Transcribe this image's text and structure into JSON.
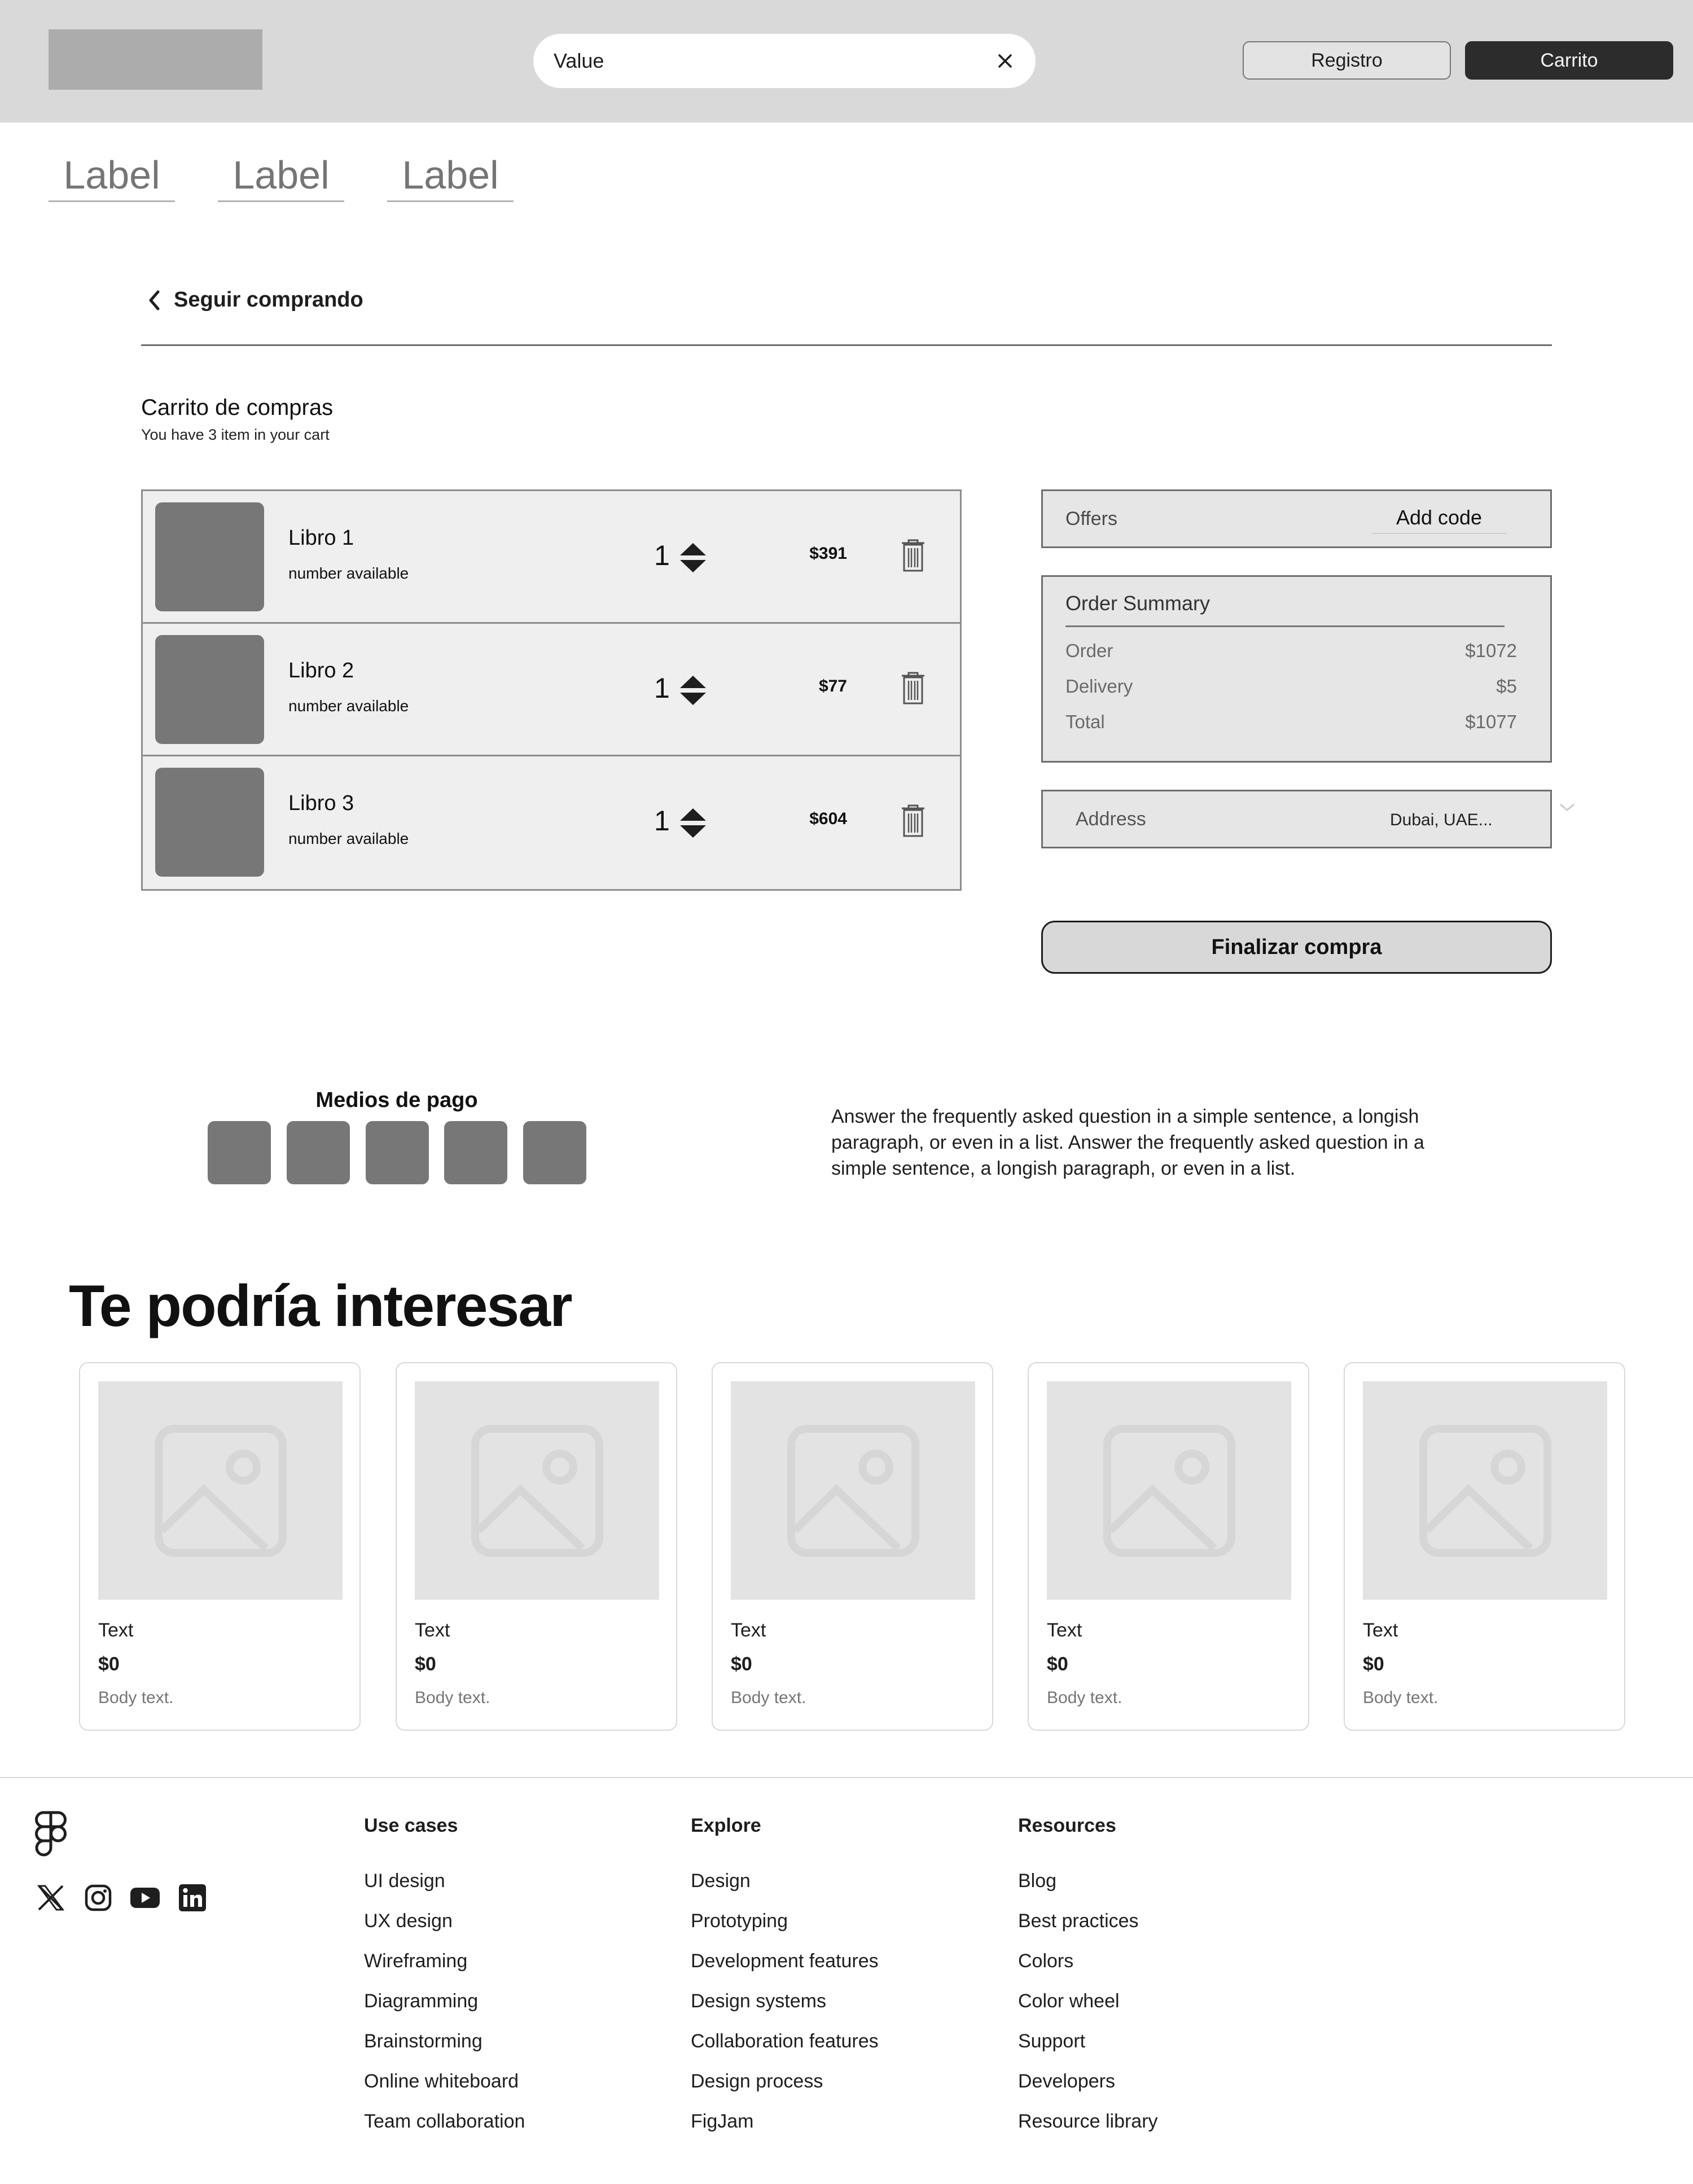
{
  "header": {
    "search_value": "Value",
    "registro_label": "Registro",
    "carrito_label": "Carrito"
  },
  "tabs": [
    "Label",
    "Label",
    "Label"
  ],
  "back_link": "Seguir comprando",
  "cart": {
    "title": "Carrito de compras",
    "subtitle": "You have 3 item in your cart",
    "items": [
      {
        "name": "Libro 1",
        "availability": "number available",
        "qty": "1",
        "price": "$391"
      },
      {
        "name": "Libro 2",
        "availability": "number available",
        "qty": "1",
        "price": "$77"
      },
      {
        "name": "Libro 3",
        "availability": "number available",
        "qty": "1",
        "price": "$604"
      }
    ]
  },
  "offers": {
    "label": "Offers",
    "code": "Add code"
  },
  "summary": {
    "title": "Order Summary",
    "rows": [
      {
        "label": "Order",
        "value": "$1072"
      },
      {
        "label": "Delivery",
        "value": "$5"
      },
      {
        "label": "Total",
        "value": "$1077"
      }
    ]
  },
  "address": {
    "label": "Address",
    "value": "Dubai, UAE..."
  },
  "checkout_label": "Finalizar compra",
  "payments_title": "Medios de pago",
  "faq_text": "Answer the frequently asked question in a simple sentence, a longish paragraph, or even in a list. Answer the frequently asked question in a simple sentence, a longish paragraph, or even in a list.",
  "recommendations": {
    "title": "Te podría interesar",
    "cards": [
      {
        "text": "Text",
        "price": "$0",
        "body": "Body text."
      },
      {
        "text": "Text",
        "price": "$0",
        "body": "Body text."
      },
      {
        "text": "Text",
        "price": "$0",
        "body": "Body text."
      },
      {
        "text": "Text",
        "price": "$0",
        "body": "Body text."
      },
      {
        "text": "Text",
        "price": "$0",
        "body": "Body text."
      }
    ]
  },
  "footer": {
    "social_icons": [
      "x-icon",
      "instagram-icon",
      "youtube-icon",
      "linkedin-icon"
    ],
    "columns": [
      {
        "title": "Use cases",
        "links": [
          "UI design",
          "UX design",
          "Wireframing",
          "Diagramming",
          "Brainstorming",
          "Online whiteboard",
          "Team collaboration"
        ]
      },
      {
        "title": "Explore",
        "links": [
          "Design",
          "Prototyping",
          "Development features",
          "Design systems",
          "Collaboration features",
          "Design process",
          "FigJam"
        ]
      },
      {
        "title": "Resources",
        "links": [
          "Blog",
          "Best practices",
          "Colors",
          "Color wheel",
          "Support",
          "Developers",
          "Resource library"
        ]
      }
    ]
  }
}
